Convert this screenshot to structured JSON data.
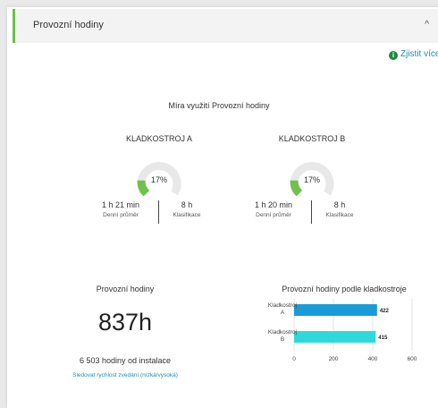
{
  "header": {
    "title": "Provozní hodiny",
    "chevron": "^"
  },
  "more_link": {
    "label": "Zjistit více",
    "icon": "info-icon"
  },
  "utilization_title": "Míra využití Provozní hodiny",
  "machines": [
    {
      "name": "KLADKOSTROJ A",
      "percent_label": "17%",
      "percent": 17,
      "daily_avg_value": "1 h 21 min",
      "daily_avg_label": "Denní průměr",
      "class_value": "8 h",
      "class_label": "Klasifikace"
    },
    {
      "name": "KLADKOSTROJ B",
      "percent_label": "17%",
      "percent": 17,
      "daily_avg_value": "1 h 20 min",
      "daily_avg_label": "Denní průměr",
      "class_value": "8 h",
      "class_label": "Klasifikace"
    }
  ],
  "operating_hours": {
    "title": "Provozní hodiny",
    "value": "837h",
    "since_install": "6 503 hodiny od instalace",
    "link": "Sledovat rychlost zvedání (nízká/vysoká)"
  },
  "colors": {
    "accent_green": "#6cc24a",
    "gauge_track": "#e8e8e8",
    "gauge_fill": "#6cc24a",
    "bar_a": "#1a9bd7",
    "bar_b": "#2fd9d9",
    "link": "#1a8fb3"
  },
  "chart_data": {
    "type": "bar",
    "orientation": "horizontal",
    "title": "Provozní hodiny podle kladkostroje",
    "categories": [
      "Kladkostroj A",
      "Kladkostroj B"
    ],
    "category_lines": [
      [
        "Kladkostroj",
        "A"
      ],
      [
        "Kladkostroj",
        "B"
      ]
    ],
    "values": [
      422,
      415
    ],
    "value_labels": [
      "422",
      "415"
    ],
    "xlim": [
      0,
      600
    ],
    "xticks": [
      0,
      200,
      400,
      600
    ],
    "grid": true
  }
}
